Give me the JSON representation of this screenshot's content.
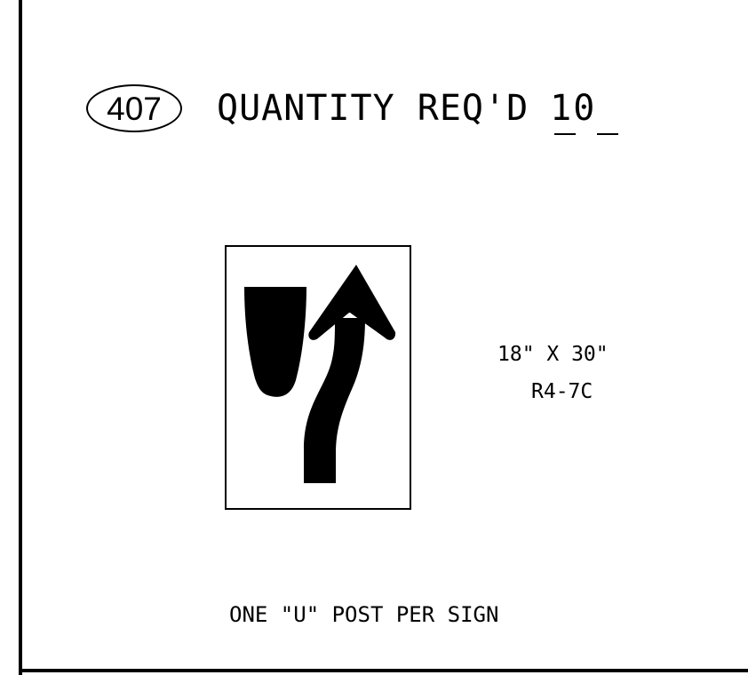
{
  "item": {
    "number": "407"
  },
  "quantity": {
    "label": "QUANTITY REQ'D",
    "value": "10"
  },
  "sign": {
    "size": "18\" X 30\"",
    "code": "R4-7C",
    "symbol": "keep-right-arrow-icon"
  },
  "note": "ONE \"U\" POST PER SIGN"
}
